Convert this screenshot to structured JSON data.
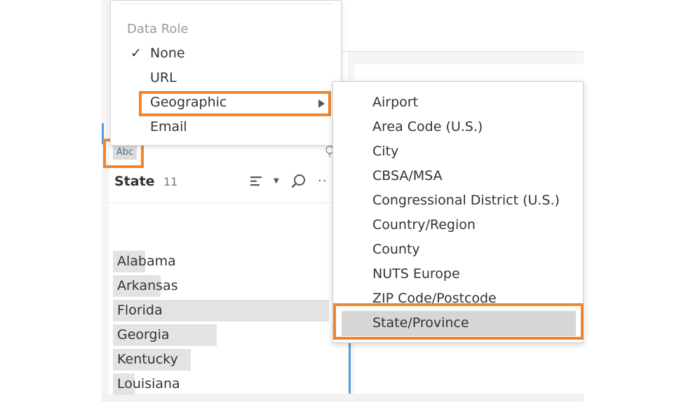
{
  "data_role_menu": {
    "header": "Data Role",
    "items": [
      {
        "label": "None",
        "checked": true
      },
      {
        "label": "URL"
      },
      {
        "label": "Geographic",
        "has_submenu": true,
        "highlighted": true
      },
      {
        "label": "Email"
      }
    ]
  },
  "geographic_submenu": {
    "items": [
      {
        "label": "Airport"
      },
      {
        "label": "Area Code (U.S.)"
      },
      {
        "label": "City"
      },
      {
        "label": "CBSA/MSA"
      },
      {
        "label": "Congressional District (U.S.)"
      },
      {
        "label": "Country/Region"
      },
      {
        "label": "County"
      },
      {
        "label": "NUTS Europe"
      },
      {
        "label": "ZIP Code/Postcode"
      },
      {
        "label": "State/Province",
        "selected": true
      }
    ]
  },
  "field_card": {
    "type_badge": "Abc",
    "field_name": "State",
    "distinct_count": "11",
    "values": [
      {
        "label": "Alabama",
        "relative_count": 0.15
      },
      {
        "label": "Arkansas",
        "relative_count": 0.22
      },
      {
        "label": "Florida",
        "relative_count": 1.0
      },
      {
        "label": "Georgia",
        "relative_count": 0.48
      },
      {
        "label": "Kentucky",
        "relative_count": 0.36
      },
      {
        "label": "Louisiana",
        "relative_count": 0.1
      }
    ],
    "icons": [
      "sort-icon",
      "search-icon",
      "more-icon",
      "lightbulb-icon"
    ]
  },
  "colors": {
    "highlight_border": "#f0852d",
    "selection_bar": "#5b9bd5",
    "value_bar": "#e3e3e3",
    "selected_item_bg": "#d6d6d6"
  }
}
